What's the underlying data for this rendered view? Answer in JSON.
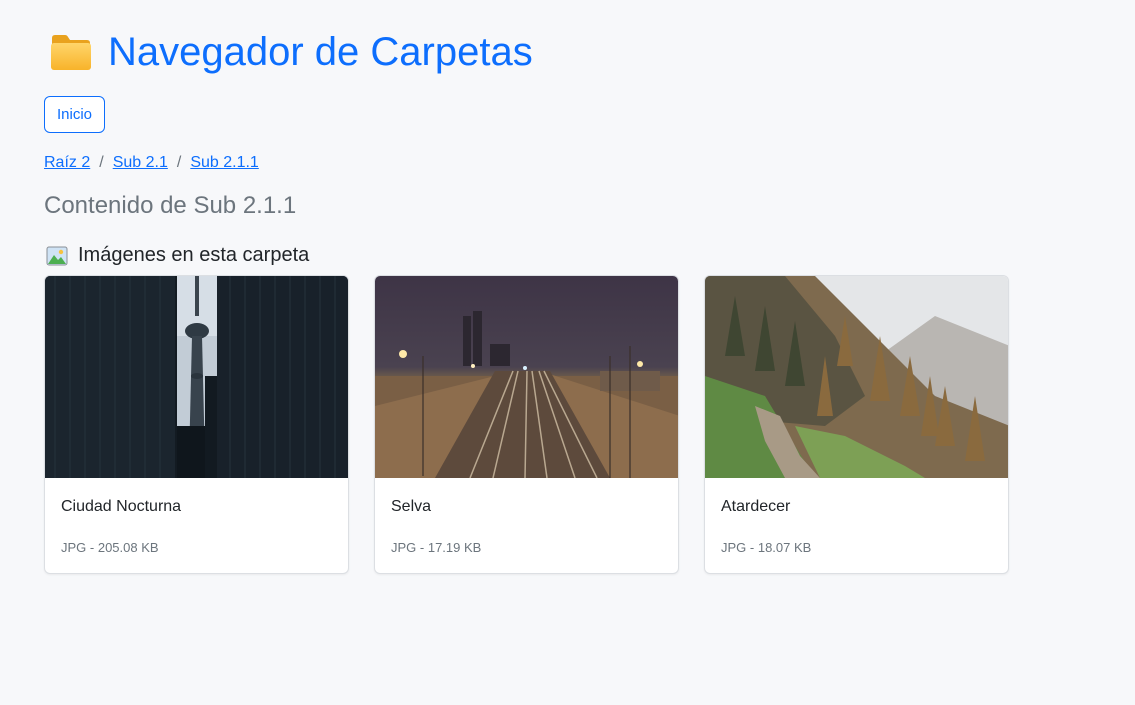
{
  "header": {
    "icon": "folder-icon",
    "title": "Navegador de Carpetas"
  },
  "home_button": {
    "label": "Inicio"
  },
  "breadcrumb": [
    {
      "label": "Raíz 2"
    },
    {
      "label": "Sub 2.1"
    },
    {
      "label": "Sub 2.1.1"
    }
  ],
  "breadcrumb_separator": "/",
  "section_title": "Contenido de Sub 2.1.1",
  "images_heading": {
    "icon": "picture-icon",
    "label": "Imágenes en esta carpeta"
  },
  "images": [
    {
      "title": "Ciudad Nocturna",
      "meta": "JPG - 205.08 KB",
      "thumbnail": "city-tower-photo"
    },
    {
      "title": "Selva",
      "meta": "JPG - 17.19 KB",
      "thumbnail": "railway-night-photo"
    },
    {
      "title": "Atardecer",
      "meta": "JPG - 18.07 KB",
      "thumbnail": "foggy-forest-photo"
    }
  ],
  "colors": {
    "accent": "#0d6efd",
    "muted": "#6c757d",
    "background": "#f7f8fa"
  }
}
